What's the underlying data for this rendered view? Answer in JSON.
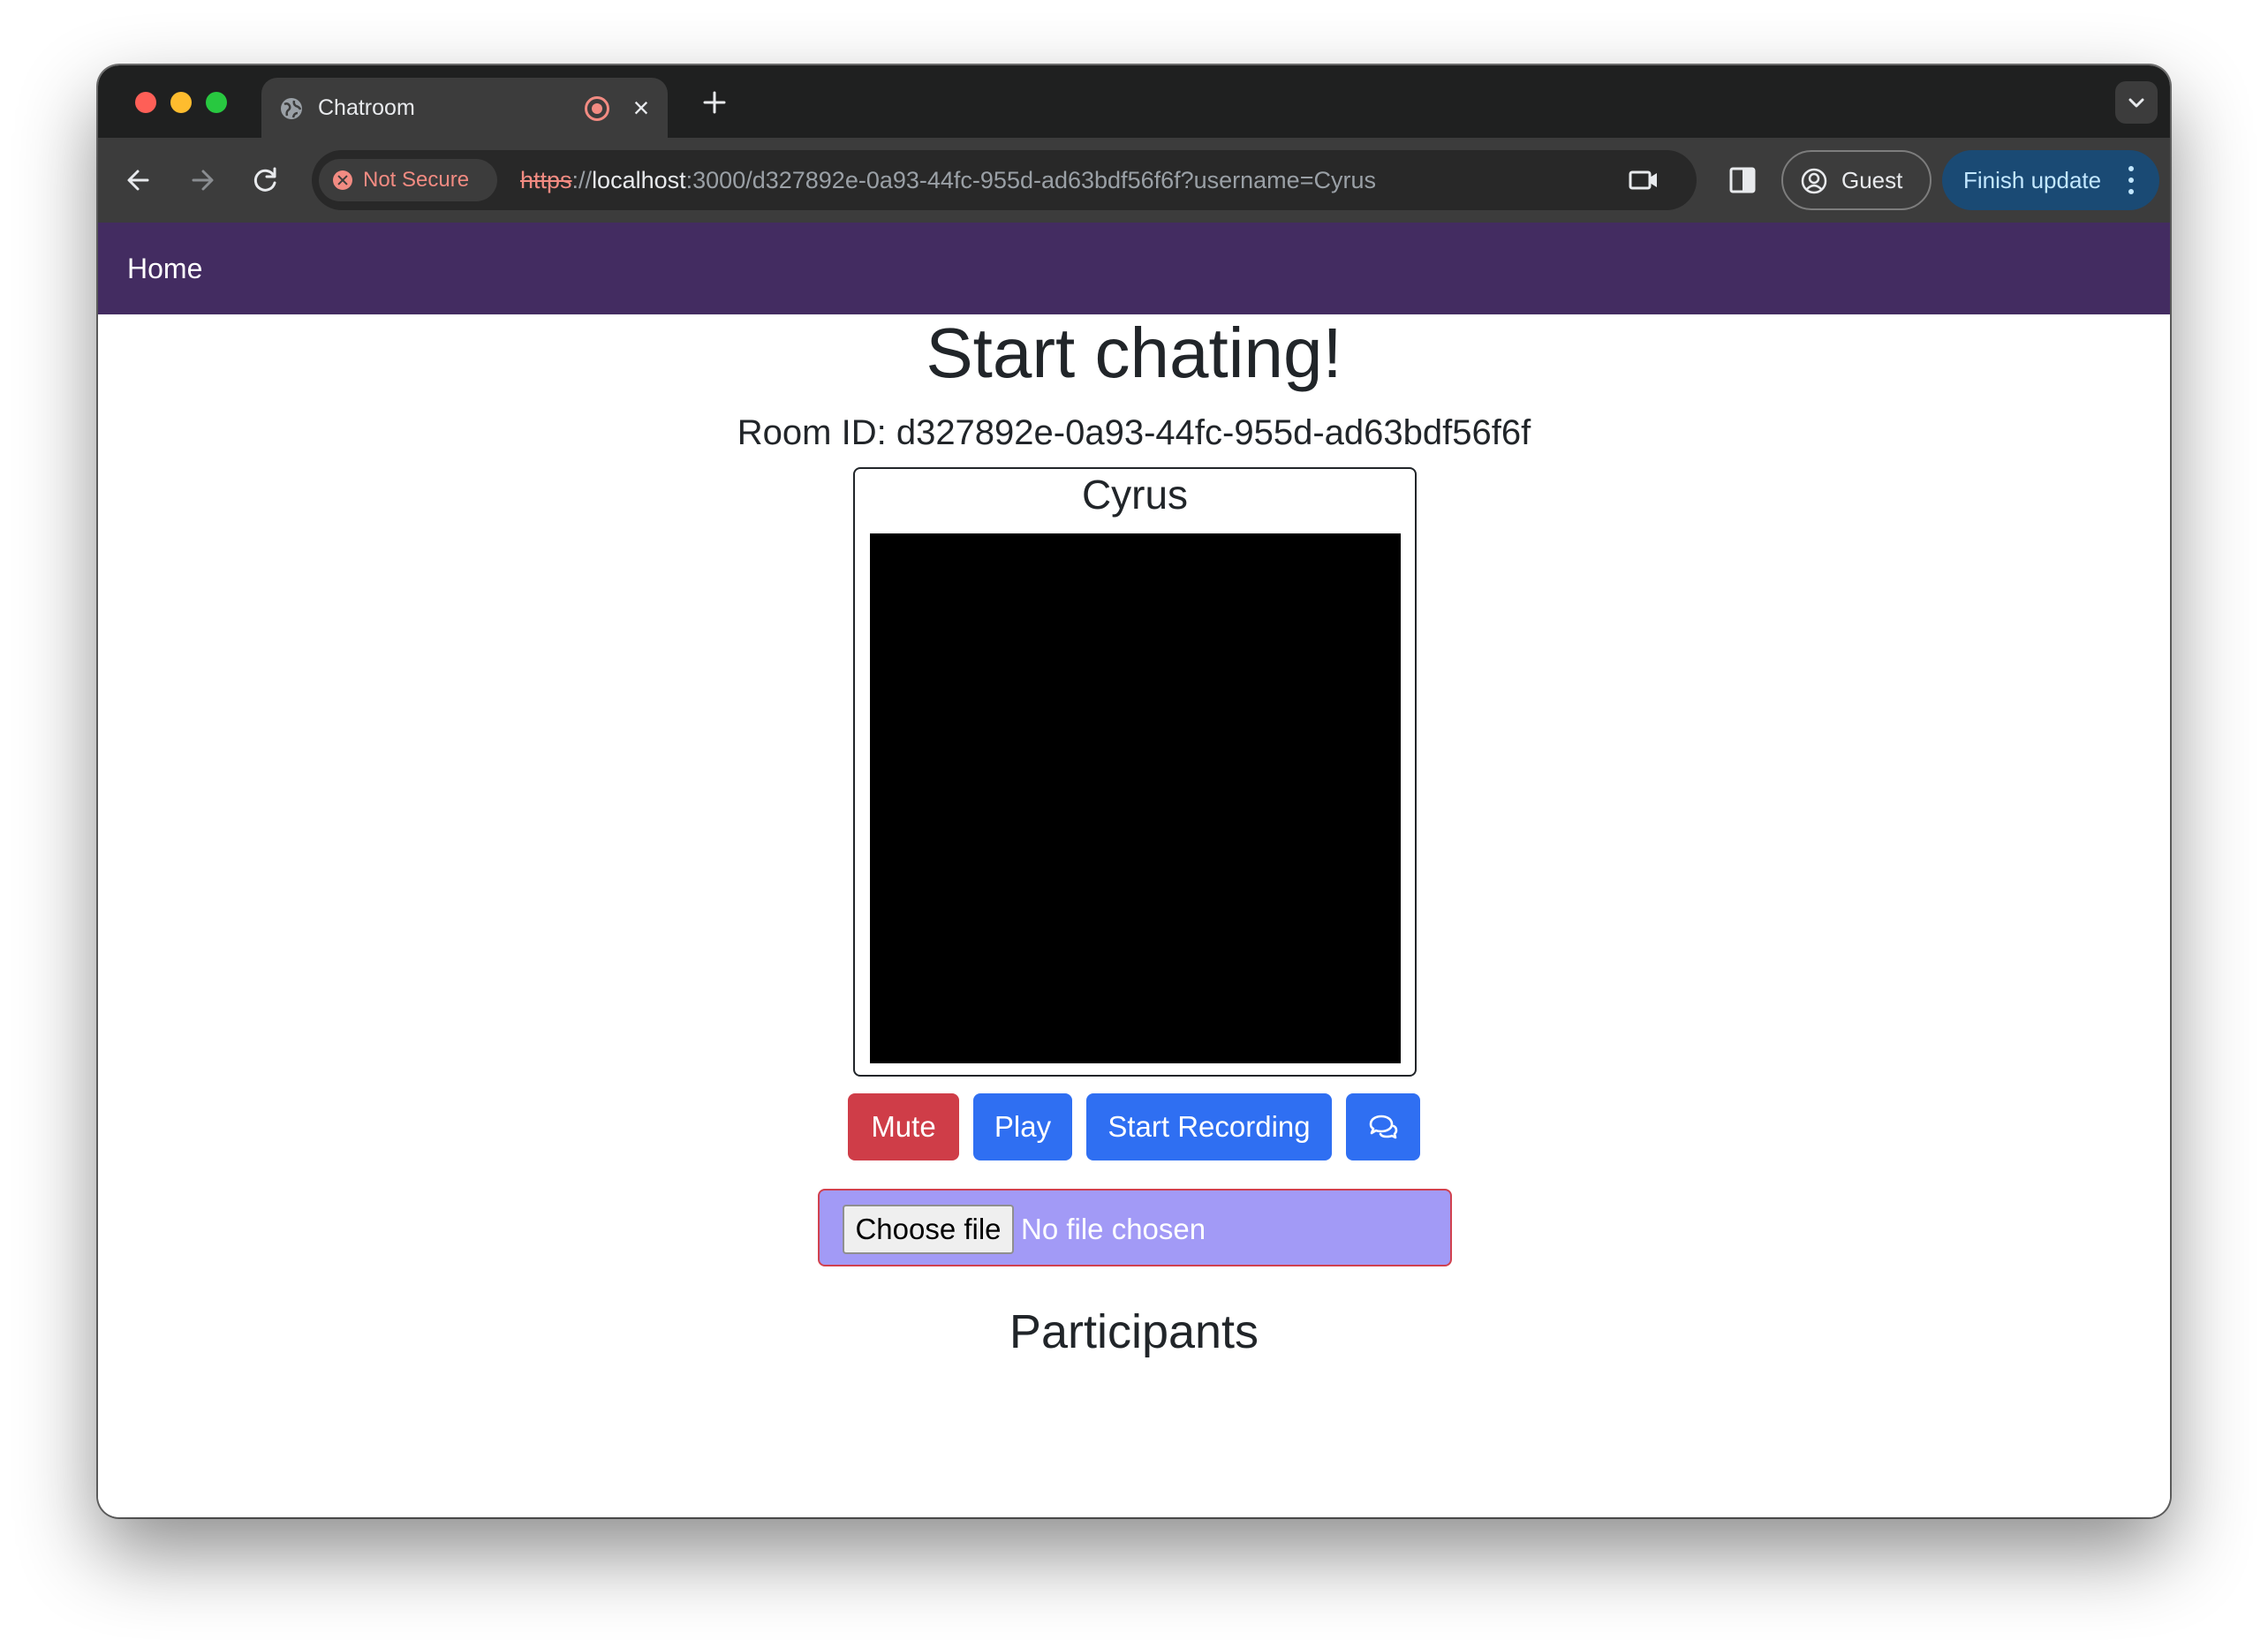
{
  "browser": {
    "tab": {
      "title": "Chatroom",
      "favicon": "globe-icon",
      "status_icon": "recording-icon",
      "close_icon": "close-icon"
    },
    "new_tab_icon": "plus-icon",
    "tab_search_icon": "chevron-down-icon",
    "nav": {
      "back_icon": "arrow-left-icon",
      "forward_icon": "arrow-right-icon",
      "reload_icon": "reload-icon"
    },
    "security_label": "Not Secure",
    "url": {
      "scheme": "https",
      "separator": "://",
      "host": "localhost",
      "path": ":3000/d327892e-0a93-44fc-955d-ad63bdf56f6f?username=Cyrus"
    },
    "profile_label": "Guest",
    "update_label": "Finish update",
    "colors": {
      "titlebar": "#1f2020",
      "toolbar": "#3c3c3c",
      "insecure": "#f28b82",
      "update_chip": "#1a4a74"
    }
  },
  "page": {
    "navbar": {
      "home_label": "Home",
      "color": "#432c61"
    },
    "title": "Start chating!",
    "room_id_text": "Room ID: d327892e-0a93-44fc-955d-ad63bdf56f6f",
    "video": {
      "participant_name": "Cyrus"
    },
    "controls": {
      "mute_label": "Mute",
      "play_label": "Play",
      "record_label": "Start Recording",
      "chat_icon": "chat-bubbles-icon",
      "danger_color": "#cf3d48",
      "primary_color": "#2f6ff2"
    },
    "file_input": {
      "button_label": "Choose file",
      "status": "No file chosen",
      "background": "#a29af6"
    },
    "participants_heading": "Participants"
  }
}
